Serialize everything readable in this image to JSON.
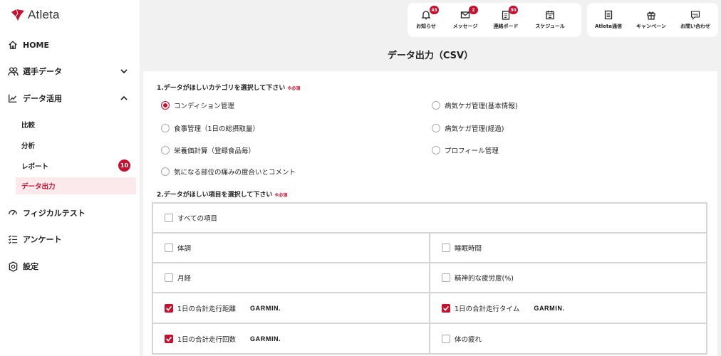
{
  "brand": {
    "name": "Atleta",
    "color": "#c8102e"
  },
  "sidebar": {
    "items": [
      {
        "label": "HOME",
        "icon": "home-icon"
      },
      {
        "label": "選手データ",
        "icon": "users-icon"
      },
      {
        "label": "データ活用",
        "icon": "chart-line-icon"
      },
      {
        "label": "フィジカルテスト",
        "icon": "physical-test-icon"
      },
      {
        "label": "アンケート",
        "icon": "checklist-icon"
      },
      {
        "label": "設定",
        "icon": "gear-icon"
      }
    ],
    "sub_items": [
      {
        "label": "比較"
      },
      {
        "label": "分析"
      },
      {
        "label": "レポート",
        "badge": "10"
      },
      {
        "label": "データ出力"
      }
    ]
  },
  "topbar": {
    "left": [
      {
        "label": "お知らせ",
        "badge": "43",
        "icon": "bell-icon"
      },
      {
        "label": "メッセージ",
        "badge": "2",
        "icon": "mail-icon"
      },
      {
        "label": "連絡ボード",
        "badge": "30",
        "icon": "clipboard-icon"
      },
      {
        "label": "スケジュール",
        "icon": "calendar-icon"
      }
    ],
    "right": [
      {
        "label": "Atleta通信",
        "icon": "newsletter-icon"
      },
      {
        "label": "キャンペーン",
        "icon": "gift-icon"
      },
      {
        "label": "お問い合わせ",
        "icon": "faq-icon",
        "icon_text": "FAQ"
      }
    ]
  },
  "page": {
    "title": "データ出力（CSV）"
  },
  "section1": {
    "label": "1.データがほしいカテゴリを選択して下さい",
    "required": "※必須",
    "options": [
      {
        "label": "コンディション管理",
        "selected": true
      },
      {
        "label": "病気ケガ管理(基本情報)",
        "selected": false
      },
      {
        "label": "食事管理（1日の総摂取量）",
        "selected": false
      },
      {
        "label": "病気ケガ管理(経過)",
        "selected": false
      },
      {
        "label": "栄養価計算（登録食品毎）",
        "selected": false
      },
      {
        "label": "プロフィール管理",
        "selected": false
      },
      {
        "label": "気になる部位の痛みの度合いとコメント",
        "selected": false
      }
    ]
  },
  "section2": {
    "label": "2.データがほしい項目を選択して下さい",
    "required": "※必須",
    "all_label": "すべての項目",
    "items": [
      {
        "label": "体調",
        "checked": false
      },
      {
        "label": "睡眠時間",
        "checked": false
      },
      {
        "label": "月経",
        "checked": false
      },
      {
        "label": "精神的な疲労度(%)",
        "checked": false
      },
      {
        "label": "1日の合計走行距離",
        "checked": true,
        "tag": "GARMIN."
      },
      {
        "label": "1日の合計走行タイム",
        "checked": true,
        "tag": "GARMIN."
      },
      {
        "label": "1日の合計走行回数",
        "checked": true,
        "tag": "GARMIN."
      },
      {
        "label": "体の疲れ",
        "checked": false
      }
    ]
  }
}
